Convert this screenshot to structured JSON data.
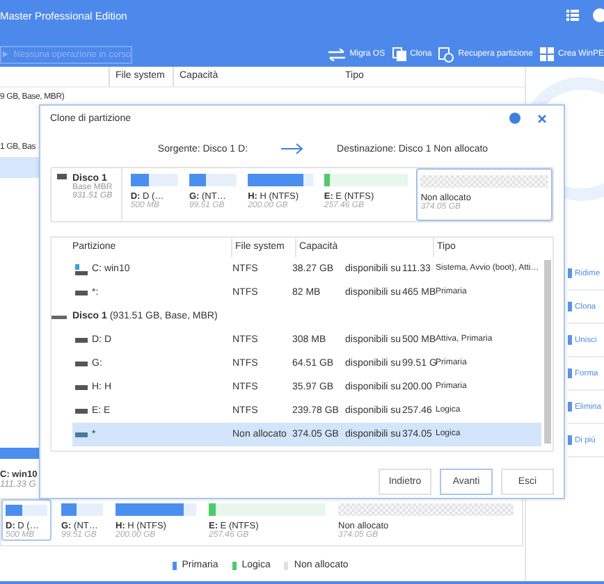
{
  "window": {
    "title": "Master Professional Edition"
  },
  "toolbar": {
    "status": "Nessuna operazione in corso",
    "actions": [
      {
        "kind": "migrate",
        "label": "Migra OS"
      },
      {
        "kind": "clone",
        "label": "Clona"
      },
      {
        "kind": "recover",
        "label": "Recupera partizione"
      },
      {
        "kind": "winpe",
        "label": "Crea WinPE"
      }
    ]
  },
  "partition_list": {
    "columns": [
      "File system",
      "Capacità",
      "Tipo"
    ],
    "disk_rows": [
      "9 GB, Base, MBR)",
      "1 GB, Bas"
    ],
    "c_partition": {
      "label": "C: win10",
      "size": "111.33 G"
    }
  },
  "side_actions": [
    "Ridime",
    "Clona",
    "Unisci",
    "Forma",
    "Elimina",
    "Di più"
  ],
  "disk_map": [
    {
      "kind": "primary",
      "label": "**D:** D (…",
      "size": "500 MB",
      "level": 0.4,
      "selected": true
    },
    {
      "kind": "primary",
      "label": "**G:**  (NT…",
      "size": "99.51 GB",
      "level": 0.35,
      "selected": false
    },
    {
      "kind": "primary",
      "label": "**H:** H (NTFS)",
      "size": "200.00 GB",
      "level": 0.85,
      "selected": false
    },
    {
      "kind": "logical",
      "label": "**E:** E (NTFS)",
      "size": "257.46 GB",
      "level": 0.06,
      "selected": false
    },
    {
      "kind": "unallocated",
      "label": "Non allocato",
      "size": "374.05 GB",
      "selected": false
    }
  ],
  "legend": [
    {
      "kind": "primary",
      "label": "Primaria"
    },
    {
      "kind": "logical",
      "label": "Logica"
    },
    {
      "kind": "unallocated",
      "label": "Non allocato"
    }
  ],
  "dialog": {
    "title": "Clone di partizione",
    "source": "Sorgente: Disco 1 D:",
    "destination": "Destinazione: Disco 1 Non allocato",
    "disk": {
      "name": "Disco 1",
      "type": "Base MBR",
      "size": "931.51 GB"
    },
    "map": [
      {
        "kind": "primary",
        "label": "**D:** D (…",
        "size": "500 MB",
        "level": 0.4,
        "selected": false
      },
      {
        "kind": "primary",
        "label": "**G:**  (NT…",
        "size": "99.51 GB",
        "level": 0.35,
        "selected": false
      },
      {
        "kind": "primary",
        "label": "**H:** H (NTFS)",
        "size": "200.00 GB",
        "level": 0.85,
        "selected": false
      },
      {
        "kind": "logical",
        "label": "**E:** E (NTFS)",
        "size": "257.46 GB",
        "level": 0.06,
        "selected": false
      },
      {
        "kind": "unallocated",
        "label": "Non allocato",
        "size": "374.05 GB",
        "selected": true
      }
    ],
    "columns": [
      "Partizione",
      "File system",
      "Capacità",
      "Tipo"
    ],
    "rows": [
      {
        "kind": "system",
        "name": "C: win10",
        "fs": "NTFS",
        "free": "38.27 GB",
        "of": "disponibili su",
        "total": "111.33",
        "type": "Sistema, Avvio (boot), Atti…",
        "selected": false
      },
      {
        "kind": "drive",
        "name": "*:",
        "fs": "NTFS",
        "free": "82 MB",
        "of": "disponibili su",
        "total": "465 MB",
        "type": "Primaria",
        "selected": false
      },
      {
        "kind": "disk",
        "name": "**Disco 1** (931.51 GB, Base, MBR)",
        "children": [
          {
            "kind": "drive",
            "name": "D: D",
            "fs": "NTFS",
            "free": "308 MB",
            "of": "disponibili su",
            "total": "500 MB",
            "type": "Attiva, Primaria",
            "selected": false
          },
          {
            "kind": "drive",
            "name": "G:",
            "fs": "NTFS",
            "free": "64.51 GB",
            "of": "disponibili su",
            "total": "99.51 G",
            "type": "Primaria",
            "selected": false
          },
          {
            "kind": "drive",
            "name": "H: H",
            "fs": "NTFS",
            "free": "35.97 GB",
            "of": "disponibili su",
            "total": "200.00",
            "type": "Primaria",
            "selected": false
          },
          {
            "kind": "drive",
            "name": "E: E",
            "fs": "NTFS",
            "free": "239.78 GB",
            "of": "disponibili su",
            "total": "257.46",
            "type": "Logica",
            "selected": false
          },
          {
            "kind": "unallocated",
            "name": "*",
            "fs": "Non allocato",
            "free": "374.05 GB",
            "of": "disponibili su",
            "total": "374.05",
            "type": "Logica",
            "selected": true
          }
        ]
      }
    ],
    "buttons": [
      {
        "label": "Indietro",
        "default": false
      },
      {
        "label": "Avanti",
        "default": true
      },
      {
        "label": "Esci",
        "default": false
      }
    ]
  }
}
